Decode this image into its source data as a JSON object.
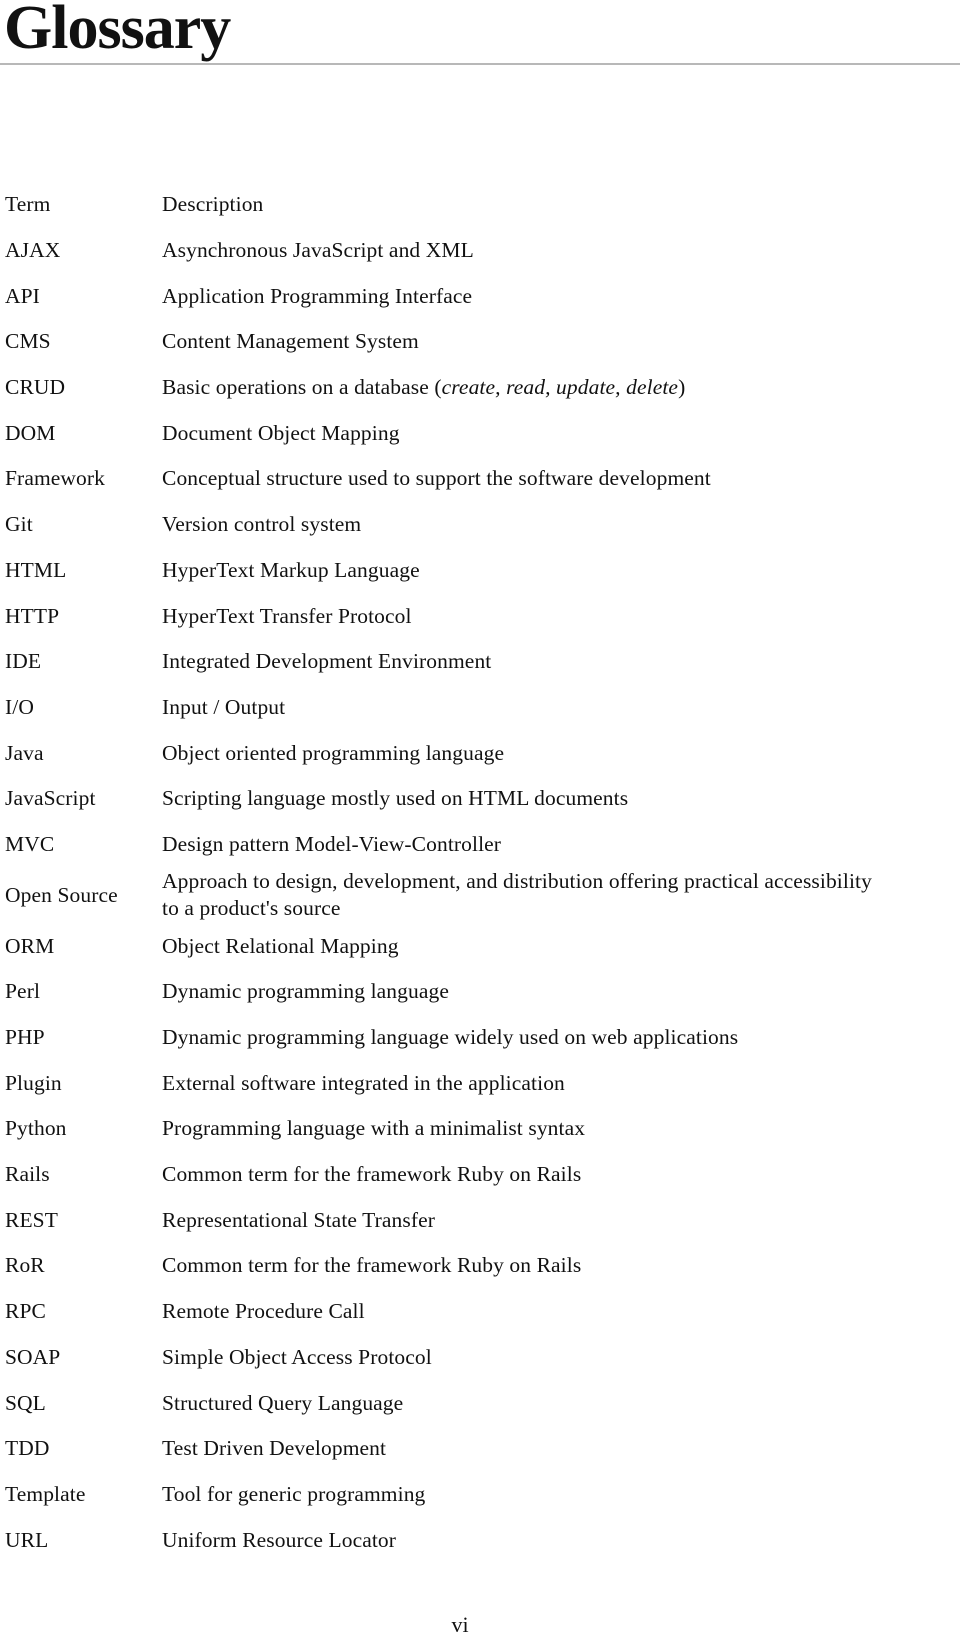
{
  "page": {
    "title": "Glossary",
    "page_number": "vi"
  },
  "table": {
    "headers": {
      "term": "Term",
      "description": "Description"
    },
    "rows": [
      {
        "term": "AJAX",
        "description": "Asynchronous JavaScript and XML"
      },
      {
        "term": "API",
        "description": "Application Programming Interface"
      },
      {
        "term": "CMS",
        "description": "Content Management System"
      },
      {
        "term": "CRUD",
        "description": "Basic operations on a database (",
        "description_italic": "create, read, update, delete",
        "description_after": ")"
      },
      {
        "term": "DOM",
        "description": "Document Object Mapping"
      },
      {
        "term": "Framework",
        "description": "Conceptual structure used to support the software development"
      },
      {
        "term": "Git",
        "description": "Version control system"
      },
      {
        "term": "HTML",
        "description": "HyperText Markup Language"
      },
      {
        "term": "HTTP",
        "description": "HyperText Transfer Protocol"
      },
      {
        "term": "IDE",
        "description": "Integrated Development Environment"
      },
      {
        "term": "I/O",
        "description": "Input / Output"
      },
      {
        "term": "Java",
        "description": "Object oriented programming language"
      },
      {
        "term": "JavaScript",
        "description": "Scripting language mostly used on HTML documents"
      },
      {
        "term": "MVC",
        "description": "Design pattern Model-View-Controller"
      },
      {
        "term": "Open Source",
        "description": "Approach to design, development, and distribution offering practical accessibility to a product's source"
      },
      {
        "term": "ORM",
        "description": "Object Relational Mapping"
      },
      {
        "term": "Perl",
        "description": "Dynamic programming language"
      },
      {
        "term": "PHP",
        "description": "Dynamic programming language widely used on web applications"
      },
      {
        "term": "Plugin",
        "description": "External software integrated in the application"
      },
      {
        "term": "Python",
        "description": "Programming language with a minimalist syntax"
      },
      {
        "term": "Rails",
        "description": "Common term for the framework Ruby on Rails"
      },
      {
        "term": "REST",
        "description": "Representational State Transfer"
      },
      {
        "term": "RoR",
        "description": "Common term for the framework Ruby on Rails"
      },
      {
        "term": "RPC",
        "description": "Remote Procedure Call"
      },
      {
        "term": "SOAP",
        "description": "Simple Object Access Protocol"
      },
      {
        "term": "SQL",
        "description": "Structured Query Language"
      },
      {
        "term": "TDD",
        "description": "Test Driven Development"
      },
      {
        "term": "Template",
        "description": "Tool for generic programming"
      },
      {
        "term": "URL",
        "description": "Uniform Resource Locator"
      }
    ]
  }
}
